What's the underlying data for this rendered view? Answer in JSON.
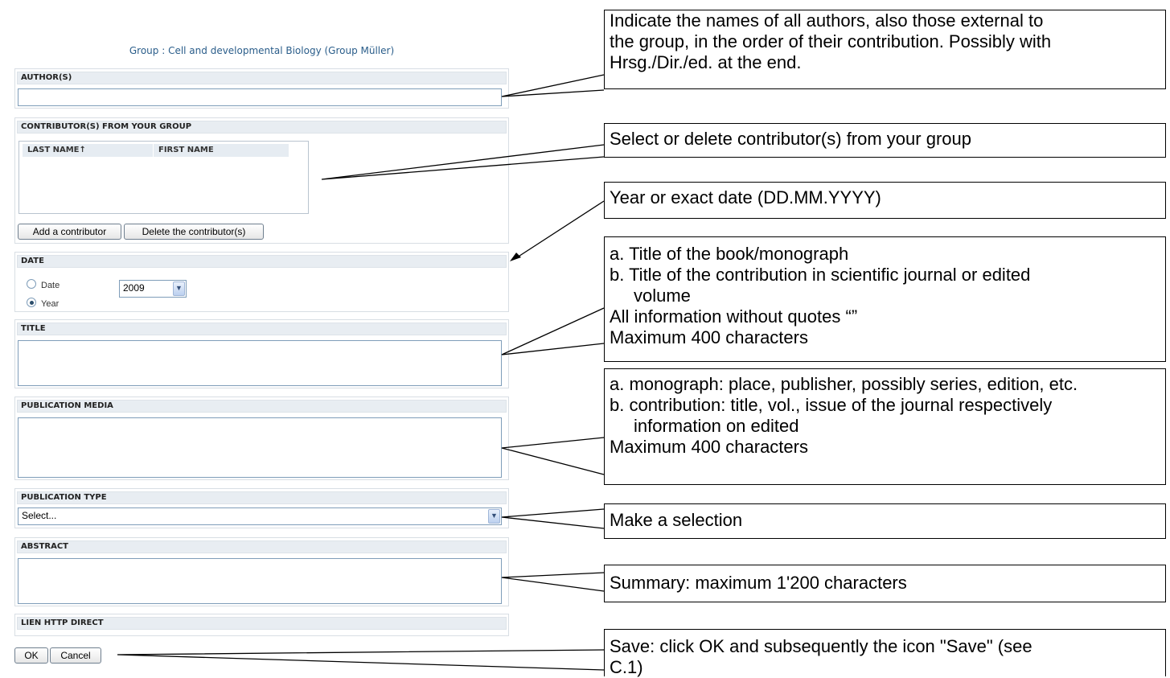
{
  "group_title": "Group : Cell and developmental Biology (Group Müller)",
  "sections": {
    "authors": {
      "label": "AUTHOR(S)",
      "value": ""
    },
    "contributors": {
      "label": "CONTRIBUTOR(S) FROM YOUR GROUP",
      "columns": [
        "LAST NAME↑",
        "FIRST NAME"
      ],
      "add_button": "Add a contributor",
      "delete_button": "Delete the contributor(s)"
    },
    "date": {
      "label": "DATE",
      "radio_date": "Date",
      "radio_year": "Year",
      "selected_radio": "Year",
      "year_value": "2009"
    },
    "title": {
      "label": "TITLE",
      "value": ""
    },
    "publication_media": {
      "label": "PUBLICATION MEDIA",
      "value": ""
    },
    "publication_type": {
      "label": "PUBLICATION TYPE",
      "selected": "Select..."
    },
    "abstract": {
      "label": "ABSTRACT",
      "value": ""
    },
    "link": {
      "label": "LIEN HTTP DIRECT"
    }
  },
  "buttons": {
    "ok": "OK",
    "cancel": "Cancel"
  },
  "callouts": {
    "authors": [
      "Indicate the names of all authors, also those external to",
      "the group, in the order of their contribution. Possibly with",
      "Hrsg./Dir./ed. at the end."
    ],
    "contributors": "Select or delete contributor(s) from your group",
    "date": "Year or exact date (DD.MM.YYYY)",
    "title": [
      "a. Title of the book/monograph",
      "b. Title of the contribution in scientific journal or edited",
      "volume",
      "All information without quotes “”",
      "Maximum 400 characters"
    ],
    "media": [
      "a. monograph: place, publisher, possibly series, edition, etc.",
      "b. contribution: title, vol., issue of the journal respectively",
      "information on edited",
      "Maximum 400 characters"
    ],
    "type": "Make a selection",
    "abstract": "Summary: maximum 1'200 characters",
    "save": [
      "Save: click OK and subsequently the icon \"Save\" (see",
      "C.1)"
    ]
  }
}
